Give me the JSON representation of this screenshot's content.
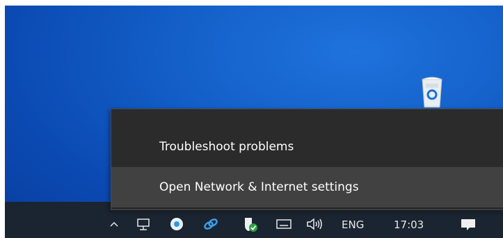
{
  "context_menu": {
    "items": [
      {
        "label": "Troubleshoot problems"
      },
      {
        "label": "Open Network & Internet settings"
      }
    ]
  },
  "tray": {
    "language": "ENG",
    "time": "17:03",
    "icons": [
      "chevron-up-icon",
      "network-wired-icon",
      "app-icon",
      "link-icon",
      "security-shield-icon",
      "keyboard-icon",
      "volume-icon",
      "notification-icon"
    ]
  },
  "desktop": {
    "icons": [
      "recycle-bin-icon"
    ]
  }
}
